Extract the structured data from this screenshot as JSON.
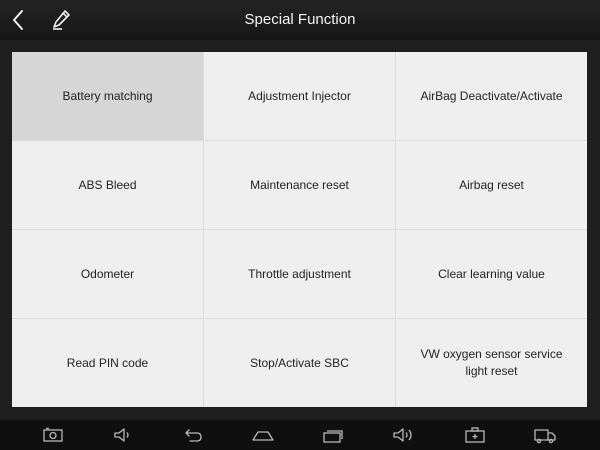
{
  "header": {
    "title": "Special Function"
  },
  "functions": [
    {
      "label": "Battery matching",
      "selected": true
    },
    {
      "label": "Adjustment Injector",
      "selected": false
    },
    {
      "label": "AirBag Deactivate/Activate",
      "selected": false
    },
    {
      "label": "ABS Bleed",
      "selected": false
    },
    {
      "label": "Maintenance reset",
      "selected": false
    },
    {
      "label": "Airbag reset",
      "selected": false
    },
    {
      "label": "Odometer",
      "selected": false
    },
    {
      "label": "Throttle adjustment",
      "selected": false
    },
    {
      "label": "Clear learning value",
      "selected": false
    },
    {
      "label": "Read PIN code",
      "selected": false
    },
    {
      "label": "Stop/Activate SBC",
      "selected": false
    },
    {
      "label": "VW oxygen sensor service light reset",
      "selected": false
    }
  ],
  "icons": {
    "header": [
      "back-arrow-icon",
      "pencil-icon"
    ],
    "navbar": [
      "screenshot-icon",
      "volume-down-icon",
      "back-icon",
      "home-icon",
      "recent-apps-icon",
      "volume-up-icon",
      "toolbox-icon",
      "truck-icon"
    ]
  },
  "colors": {
    "header_bg": "#1c1c1c",
    "content_bg": "#1f1f1f",
    "cell_bg": "#efefef",
    "cell_selected_bg": "#d6d6d6",
    "navbar_bg": "#0f0f0f"
  }
}
